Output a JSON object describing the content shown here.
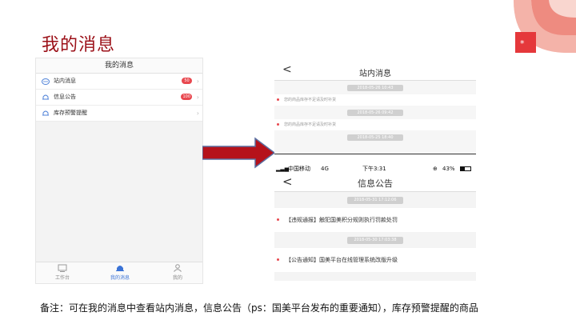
{
  "slide": {
    "title": "我的消息",
    "note": "备注：可在我的消息中查看站内消息，信息公告（ps：国美平台发布的重要通知），库存预警提醒的商品"
  },
  "colors": {
    "title": "#9b0f17",
    "badge": "#e8484f",
    "arrow": "#b5121b",
    "active_tab": "#3b73d6"
  },
  "phone_list": {
    "header": "我的消息",
    "rows": [
      {
        "icon": "mail-icon",
        "label": "站内消息",
        "badge": "50"
      },
      {
        "icon": "bell-icon",
        "label": "信息公告",
        "badge": "100"
      },
      {
        "icon": "bell-icon",
        "label": "库存预警提醒",
        "badge": ""
      }
    ],
    "tabs": [
      {
        "icon": "home-icon",
        "label": "工作台"
      },
      {
        "icon": "bell-icon",
        "label": "我的消息"
      },
      {
        "icon": "user-icon",
        "label": "我的"
      }
    ]
  },
  "phone_station": {
    "back": "<",
    "title": "站内消息",
    "times": [
      "2018-05-26 10:43",
      "2018-05-26 09:42",
      "2018-05-25 18:40"
    ],
    "messages": [
      "您的商品库存不足请及时补货",
      "您的商品库存不足请及时补货"
    ]
  },
  "phone_notice": {
    "status": {
      "carrier": "中国移动",
      "network": "4G",
      "time": "下午3:31",
      "battery": "43%"
    },
    "back": "<",
    "title": "信息公告",
    "items": [
      {
        "time": "2018-05-31 17:12:06",
        "text": "【违规通报】触犯国美积分规则执行罚款处罚"
      },
      {
        "time": "2018-05-30 17:03:38",
        "text": "【公告通知】国美平台在线管理系统改版升级"
      }
    ]
  }
}
